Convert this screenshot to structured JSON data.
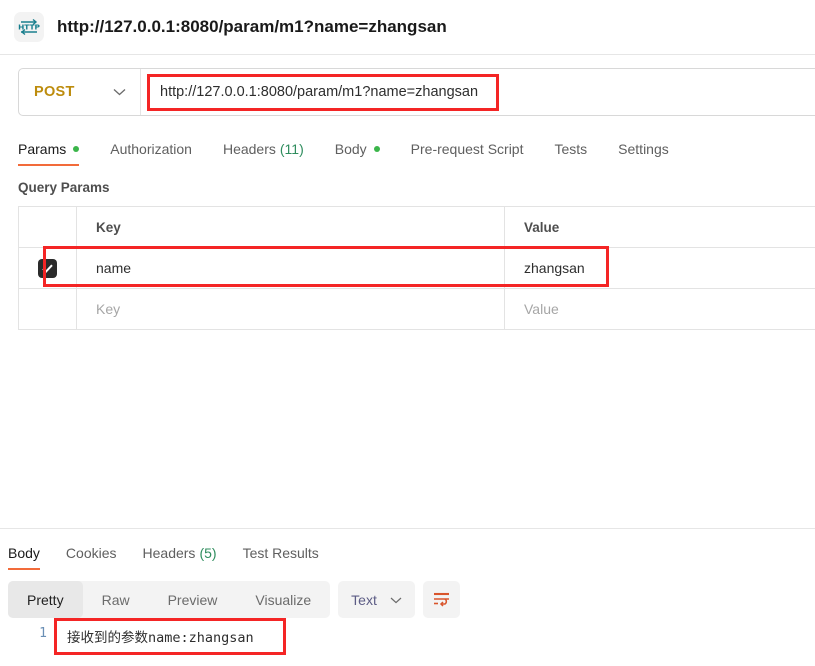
{
  "request": {
    "icon": "http-protocol-icon",
    "title": "http://127.0.0.1:8080/param/m1?name=zhangsan",
    "method": "POST",
    "url": "http://127.0.0.1:8080/param/m1?name=zhangsan",
    "tabs": [
      {
        "label": "Params",
        "dot": true,
        "active": true
      },
      {
        "label": "Authorization",
        "dot": false,
        "active": false
      },
      {
        "label": "Headers",
        "count": "(11)",
        "dot": false,
        "active": false
      },
      {
        "label": "Body",
        "dot": true,
        "active": false
      },
      {
        "label": "Pre-request Script",
        "dot": false,
        "active": false
      },
      {
        "label": "Tests",
        "dot": false,
        "active": false
      },
      {
        "label": "Settings",
        "dot": false,
        "active": false
      }
    ],
    "query_params": {
      "section_title": "Query Params",
      "columns": {
        "key": "Key",
        "value": "Value"
      },
      "rows": [
        {
          "checked": true,
          "key": "name",
          "value": "zhangsan"
        },
        {
          "checked": false,
          "key": "",
          "value": "",
          "key_placeholder": "Key",
          "value_placeholder": "Value"
        }
      ]
    }
  },
  "response": {
    "tabs": [
      {
        "label": "Body",
        "active": true
      },
      {
        "label": "Cookies",
        "active": false
      },
      {
        "label": "Headers",
        "count": "(5)",
        "active": false
      },
      {
        "label": "Test Results",
        "active": false
      }
    ],
    "view_modes": [
      "Pretty",
      "Raw",
      "Preview",
      "Visualize"
    ],
    "selected_view": "Pretty",
    "content_type": "Text",
    "wrap_icon": "word-wrap-icon",
    "body_lines": [
      {
        "number": "1",
        "text": "接收到的参数name:zhangsan"
      }
    ]
  },
  "annotations": {
    "colors": {
      "highlight": "#f42525",
      "accent": "#f26b3a",
      "method": "#bd8c0d",
      "dot": "#3bb54a"
    }
  }
}
